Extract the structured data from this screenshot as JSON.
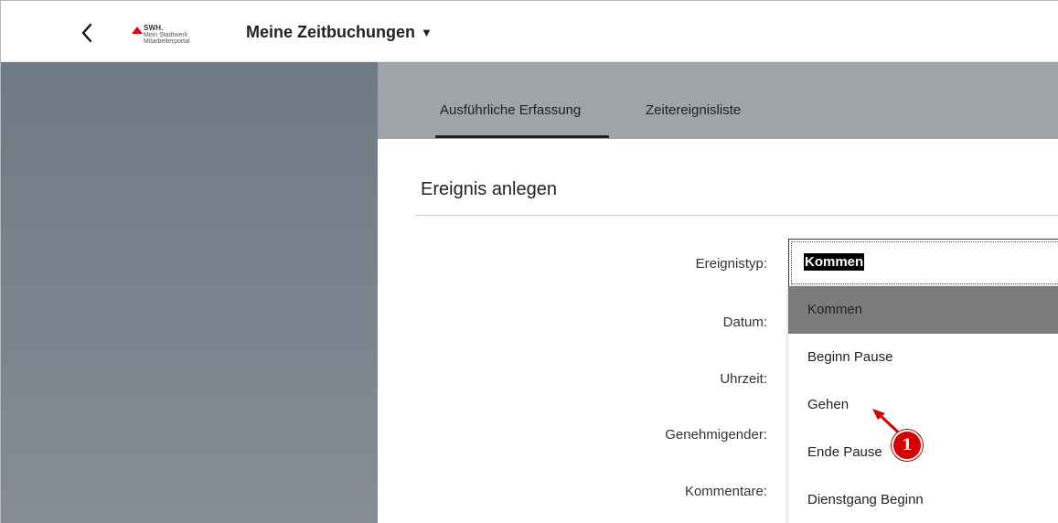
{
  "shell": {
    "back_icon": "chevron-left-icon",
    "logo": {
      "brand": "SWH.",
      "line1": "Mein Stadtwerk",
      "line2": "Mitarbeiterportal"
    },
    "title": "Meine Zeitbuchungen",
    "title_caret": "▼"
  },
  "tabs": [
    {
      "label": "Ausführliche Erfassung",
      "active": true
    },
    {
      "label": "Zeitereignisliste",
      "active": false
    }
  ],
  "form": {
    "section_title": "Ereignis anlegen",
    "labels": {
      "event_type": "Ereignistyp:",
      "date": "Datum:",
      "time": "Uhrzeit:",
      "approver": "Genehmigender:",
      "comment": "Kommentare:"
    },
    "event_type_value": "Kommen"
  },
  "dropdown": {
    "options": [
      "Kommen",
      "Beginn Pause",
      "Gehen",
      "Ende Pause",
      "Dienstgang Beginn"
    ],
    "selected_index": 0
  },
  "annotation": {
    "badge_number": "1",
    "color": "#d40000"
  },
  "colors": {
    "tabbar_bg": "#a0a3a7",
    "master_bg": "#7c858f",
    "selected_option_bg": "#7b7b7b",
    "logo_accent": "#e2001a"
  }
}
